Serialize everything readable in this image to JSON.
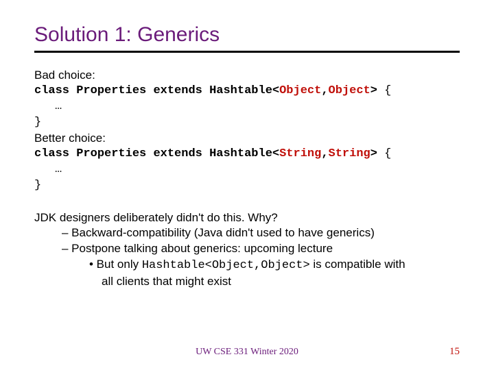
{
  "title": "Solution 1:  Generics",
  "bad_label": "Bad choice:",
  "code_class": "class",
  "code_props": "Properties",
  "code_extends": "extends",
  "code_hash": "Hashtable",
  "lt": "<",
  "gt": ">",
  "comma": ",",
  "obj": "Object",
  "str": "String",
  "brace_open": " {",
  "ellipsis": "…",
  "brace_close": "}",
  "better_label": "Better choice:",
  "jdk_line": "JDK designers deliberately didn't do this.  Why?",
  "bullet1": "–  Backward-compatibility (Java didn't used to have generics)",
  "bullet2": "–  Postpone talking about generics: upcoming lecture",
  "bullet3_pre": "•  But only ",
  "bullet3_code": "Hashtable<Object,Object>",
  "bullet3_post": " is compatible with",
  "bullet3_cont": "all clients that might exist",
  "footer": "UW CSE 331 Winter 2020",
  "pagenum": "15"
}
